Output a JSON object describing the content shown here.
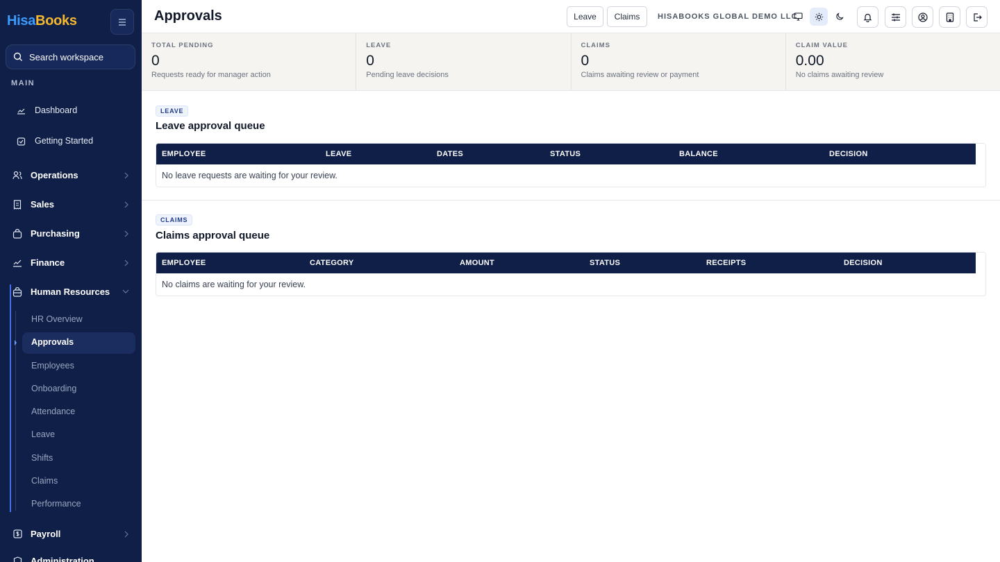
{
  "brand": {
    "part1": "Hisa",
    "part2": "Books"
  },
  "search": {
    "label": "Search workspace"
  },
  "sidebar": {
    "section_main": "MAIN",
    "items": [
      {
        "label": "Dashboard",
        "icon": "chart-line-icon"
      },
      {
        "label": "Getting Started",
        "icon": "checklist-icon"
      }
    ],
    "groups": [
      {
        "label": "Operations",
        "icon": "users-icon"
      },
      {
        "label": "Sales",
        "icon": "receipt-icon"
      },
      {
        "label": "Purchasing",
        "icon": "bag-icon"
      },
      {
        "label": "Finance",
        "icon": "trend-icon"
      },
      {
        "label": "Human Resources",
        "icon": "briefcase-icon"
      },
      {
        "label": "Payroll",
        "icon": "dollar-icon"
      },
      {
        "label": "Administration",
        "icon": "shield-icon"
      }
    ],
    "hr_items": [
      "HR Overview",
      "Approvals",
      "Employees",
      "Onboarding",
      "Attendance",
      "Leave",
      "Shifts",
      "Claims",
      "Performance"
    ]
  },
  "header": {
    "title": "Approvals",
    "leave_btn": "Leave",
    "claims_btn": "Claims",
    "company": "HISABOOKS GLOBAL DEMO LLC"
  },
  "stats": [
    {
      "label": "TOTAL PENDING",
      "value": "0",
      "sub": "Requests ready for manager action"
    },
    {
      "label": "LEAVE",
      "value": "0",
      "sub": "Pending leave decisions"
    },
    {
      "label": "CLAIMS",
      "value": "0",
      "sub": "Claims awaiting review or payment"
    },
    {
      "label": "CLAIM VALUE",
      "value": "0.00",
      "sub": "No claims awaiting review"
    }
  ],
  "leave_section": {
    "badge": "LEAVE",
    "title": "Leave approval queue",
    "columns": [
      "EMPLOYEE",
      "LEAVE",
      "DATES",
      "STATUS",
      "BALANCE",
      "DECISION"
    ],
    "empty": "No leave requests are waiting for your review."
  },
  "claims_section": {
    "badge": "CLAIMS",
    "title": "Claims approval queue",
    "columns": [
      "EMPLOYEE",
      "CATEGORY",
      "AMOUNT",
      "STATUS",
      "RECEIPTS",
      "DECISION"
    ],
    "empty": "No claims are waiting for your review."
  },
  "colors": {
    "sidebar": "#0f1f47",
    "accent": "#3b9bff",
    "brand_gold": "#f5b82e",
    "table_header": "#0f1f47"
  }
}
